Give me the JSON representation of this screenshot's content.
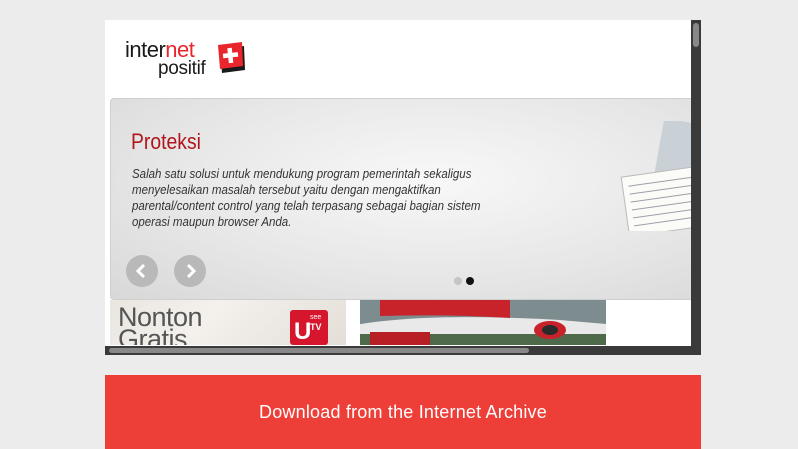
{
  "logo": {
    "line1_a": "inter",
    "line1_b": "net",
    "line2": "positif"
  },
  "banner": {
    "title": "Proteksi",
    "description": "Salah satu solusi untuk mendukung program pemerintah sekaligus menyelesaikan masalah tersebut yaitu dengan mengaktifkan parental/content control yang telah terpasang sebagai bagian sistem operasi maupun browser Anda.",
    "slide_count": 2,
    "active_slide": 2
  },
  "thumbnails": {
    "first_text_line1": "Nonton",
    "first_text_line2": "Gratis",
    "badge_u": "U",
    "badge_see": "see",
    "badge_tv": "TV"
  },
  "download": {
    "label": "Download from the Internet Archive"
  },
  "colors": {
    "accent_red": "#ee3e38",
    "title_red": "#b0151b",
    "logo_red": "#e8262b"
  }
}
